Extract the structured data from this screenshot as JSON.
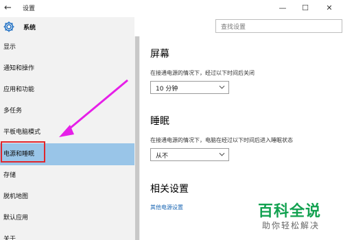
{
  "window": {
    "title": "设置",
    "back_icon": "arrow-left-icon",
    "minimize": "—",
    "maximize": "☐",
    "close": "✕"
  },
  "nav": {
    "header_label": "系统",
    "items": [
      {
        "label": "显示"
      },
      {
        "label": "通知和操作"
      },
      {
        "label": "应用和功能"
      },
      {
        "label": "多任务"
      },
      {
        "label": "平板电脑模式"
      },
      {
        "label": "电源和睡眠",
        "selected": true
      },
      {
        "label": "存储"
      },
      {
        "label": "脱机地图"
      },
      {
        "label": "默认应用"
      },
      {
        "label": "关于"
      }
    ]
  },
  "search": {
    "placeholder": "查找设置"
  },
  "screen": {
    "title": "屏幕",
    "desc": "在接通电源的情况下，经过以下时间后关闭",
    "value": "10 分钟"
  },
  "sleep": {
    "title": "睡眠",
    "desc": "在接通电源的情况下，电脑在经过以下时间后进入睡眠状态",
    "value": "从不"
  },
  "related": {
    "title": "相关设置",
    "link": "其他电源设置"
  },
  "watermark": {
    "main": "百科全说",
    "sub": "助你轻松解决"
  },
  "colors": {
    "selected_item": "#99c5e8",
    "highlight_box": "#e0252b",
    "arrow": "#e61fe8",
    "link": "#1a66b3",
    "watermark": "#12a150"
  }
}
